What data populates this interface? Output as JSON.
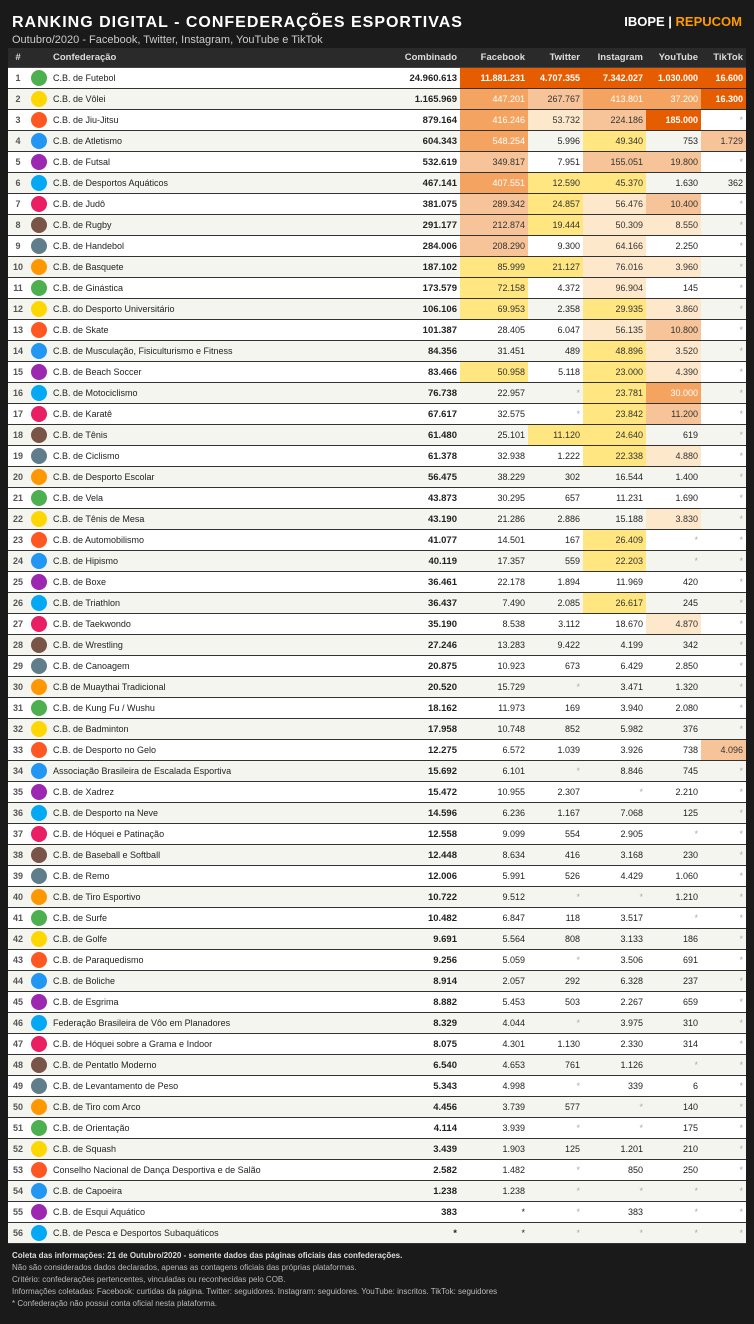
{
  "header": {
    "title": "RANKING DIGITAL - CONFEDERAÇÕES ESPORTIVAS",
    "subtitle": "Outubro/2020 - Facebook, Twitter, Instagram, YouTube e TikTok",
    "logo": "IBOPE | REPUCOM"
  },
  "columns": [
    "#",
    "",
    "Confederação",
    "Combinado",
    "Facebook",
    "Twitter",
    "Instagram",
    "YouTube",
    "TikTok"
  ],
  "rows": [
    [
      1,
      "",
      "C.B. de Futebol",
      "24.960.613",
      "11.881.231",
      "4.707.355",
      "7.342.027",
      "1.030.000",
      "16.600"
    ],
    [
      2,
      "",
      "C.B. de Vôlei",
      "1.165.969",
      "447.201",
      "267.767",
      "413.801",
      "37.200",
      "16.300"
    ],
    [
      3,
      "",
      "C.B. de Jiu-Jitsu",
      "879.164",
      "416.246",
      "53.732",
      "224.186",
      "185.000",
      "*"
    ],
    [
      4,
      "",
      "C.B. de Atletismo",
      "604.343",
      "548.254",
      "5.996",
      "49.340",
      "753",
      "1.729"
    ],
    [
      5,
      "",
      "C.B. de Futsal",
      "532.619",
      "349.817",
      "7.951",
      "155.051",
      "19.800",
      "*"
    ],
    [
      6,
      "",
      "C.B. de Desportos Aquáticos",
      "467.141",
      "407.551",
      "12.590",
      "45.370",
      "1.630",
      "362"
    ],
    [
      7,
      "",
      "C.B. de Judô",
      "381.075",
      "289.342",
      "24.857",
      "56.476",
      "10.400",
      "*"
    ],
    [
      8,
      "",
      "C.B. de Rugby",
      "291.177",
      "212.874",
      "19.444",
      "50.309",
      "8.550",
      "*"
    ],
    [
      9,
      "",
      "C.B. de Handebol",
      "284.006",
      "208.290",
      "9.300",
      "64.166",
      "2.250",
      "*"
    ],
    [
      10,
      "",
      "C.B. de Basquete",
      "187.102",
      "85.999",
      "21.127",
      "76.016",
      "3.960",
      "*"
    ],
    [
      11,
      "",
      "C.B. de Ginástica",
      "173.579",
      "72.158",
      "4.372",
      "96.904",
      "145",
      "*"
    ],
    [
      12,
      "",
      "C.B. do Desporto Universitário",
      "106.106",
      "69.953",
      "2.358",
      "29.935",
      "3.860",
      "*"
    ],
    [
      13,
      "",
      "C.B. de Skate",
      "101.387",
      "28.405",
      "6.047",
      "56.135",
      "10.800",
      "*"
    ],
    [
      14,
      "",
      "C.B. de Musculação, Fisiculturismo e Fitness",
      "84.356",
      "31.451",
      "489",
      "48.896",
      "3.520",
      "*"
    ],
    [
      15,
      "",
      "C.B. de Beach Soccer",
      "83.466",
      "50.958",
      "5.118",
      "23.000",
      "4.390",
      "*"
    ],
    [
      16,
      "",
      "C.B. de Motociclismo",
      "76.738",
      "22.957",
      "*",
      "23.781",
      "30.000",
      "*"
    ],
    [
      17,
      "",
      "C.B. de Karatê",
      "67.617",
      "32.575",
      "*",
      "23.842",
      "11.200",
      "*"
    ],
    [
      18,
      "",
      "C.B. de Tênis",
      "61.480",
      "25.101",
      "11.120",
      "24.640",
      "619",
      "*"
    ],
    [
      19,
      "",
      "C.B. de Ciclismo",
      "61.378",
      "32.938",
      "1.222",
      "22.338",
      "4.880",
      "*"
    ],
    [
      20,
      "",
      "C.B. de Desporto Escolar",
      "56.475",
      "38.229",
      "302",
      "16.544",
      "1.400",
      "*"
    ],
    [
      21,
      "",
      "C.B. de Vela",
      "43.873",
      "30.295",
      "657",
      "11.231",
      "1.690",
      "*"
    ],
    [
      22,
      "",
      "C.B. de Tênis de Mesa",
      "43.190",
      "21.286",
      "2.886",
      "15.188",
      "3.830",
      "*"
    ],
    [
      23,
      "",
      "C.B. de Automobilismo",
      "41.077",
      "14.501",
      "167",
      "26.409",
      "*",
      "*"
    ],
    [
      24,
      "",
      "C.B. de Hipismo",
      "40.119",
      "17.357",
      "559",
      "22.203",
      "*",
      "*"
    ],
    [
      25,
      "",
      "C.B. de Boxe",
      "36.461",
      "22.178",
      "1.894",
      "11.969",
      "420",
      "*"
    ],
    [
      26,
      "",
      "C.B. de Triathlon",
      "36.437",
      "7.490",
      "2.085",
      "26.617",
      "245",
      "*"
    ],
    [
      27,
      "",
      "C.B. de Taekwondo",
      "35.190",
      "8.538",
      "3.112",
      "18.670",
      "4.870",
      "*"
    ],
    [
      28,
      "",
      "C.B. de Wrestling",
      "27.246",
      "13.283",
      "9.422",
      "4.199",
      "342",
      "*"
    ],
    [
      29,
      "",
      "C.B. de Canoagem",
      "20.875",
      "10.923",
      "673",
      "6.429",
      "2.850",
      "*"
    ],
    [
      30,
      "",
      "C.B de Muaythai Tradicional",
      "20.520",
      "15.729",
      "*",
      "3.471",
      "1.320",
      "*"
    ],
    [
      31,
      "",
      "C.B. de Kung Fu / Wushu",
      "18.162",
      "11.973",
      "169",
      "3.940",
      "2.080",
      "*"
    ],
    [
      32,
      "",
      "C.B. de Badminton",
      "17.958",
      "10.748",
      "852",
      "5.982",
      "376",
      "*"
    ],
    [
      33,
      "",
      "C.B. de Desporto no Gelo",
      "12.275",
      "6.572",
      "1.039",
      "3.926",
      "738",
      "4.096"
    ],
    [
      34,
      "",
      "Associação Brasileira de Escalada Esportiva",
      "15.692",
      "6.101",
      "*",
      "8.846",
      "745",
      "*"
    ],
    [
      35,
      "",
      "C.B. de Xadrez",
      "15.472",
      "10.955",
      "2.307",
      "*",
      "2.210",
      "*"
    ],
    [
      36,
      "",
      "C.B. de Desporto na Neve",
      "14.596",
      "6.236",
      "1.167",
      "7.068",
      "125",
      "*"
    ],
    [
      37,
      "",
      "C.B. de Hóquei e Patinação",
      "12.558",
      "9.099",
      "554",
      "2.905",
      "*",
      "*"
    ],
    [
      38,
      "",
      "C.B. de Baseball e Softball",
      "12.448",
      "8.634",
      "416",
      "3.168",
      "230",
      "*"
    ],
    [
      39,
      "",
      "C.B. de Remo",
      "12.006",
      "5.991",
      "526",
      "4.429",
      "1.060",
      "*"
    ],
    [
      40,
      "",
      "C.B. de Tiro Esportivo",
      "10.722",
      "9.512",
      "*",
      "*",
      "1.210",
      "*"
    ],
    [
      41,
      "",
      "C.B. de Surfe",
      "10.482",
      "6.847",
      "118",
      "3.517",
      "*",
      "*"
    ],
    [
      42,
      "",
      "C.B. de Golfe",
      "9.691",
      "5.564",
      "808",
      "3.133",
      "186",
      "*"
    ],
    [
      43,
      "",
      "C.B. de Paraquedismo",
      "9.256",
      "5.059",
      "*",
      "3.506",
      "691",
      "*"
    ],
    [
      44,
      "",
      "C.B. de Boliche",
      "8.914",
      "2.057",
      "292",
      "6.328",
      "237",
      "*"
    ],
    [
      45,
      "",
      "C.B. de Esgrima",
      "8.882",
      "5.453",
      "503",
      "2.267",
      "659",
      "*"
    ],
    [
      46,
      "",
      "Federação Brasileira de Vôo em Planadores",
      "8.329",
      "4.044",
      "*",
      "3.975",
      "310",
      "*"
    ],
    [
      47,
      "",
      "C.B. de Hóquei sobre a Grama e Indoor",
      "8.075",
      "4.301",
      "1.130",
      "2.330",
      "314",
      "*"
    ],
    [
      48,
      "",
      "C.B. de Pentatlo Moderno",
      "6.540",
      "4.653",
      "761",
      "1.126",
      "*",
      "*"
    ],
    [
      49,
      "",
      "C.B. de Levantamento de Peso",
      "5.343",
      "4.998",
      "*",
      "339",
      "6",
      "*"
    ],
    [
      50,
      "",
      "C.B. de Tiro com Arco",
      "4.456",
      "3.739",
      "577",
      "*",
      "140",
      "*"
    ],
    [
      51,
      "",
      "C.B. de Orientação",
      "4.114",
      "3.939",
      "*",
      "*",
      "175",
      "*"
    ],
    [
      52,
      "",
      "C.B. de Squash",
      "3.439",
      "1.903",
      "125",
      "1.201",
      "210",
      "*"
    ],
    [
      53,
      "",
      "Conselho Nacional de Dança Desportiva e de Salão",
      "2.582",
      "1.482",
      "*",
      "850",
      "250",
      "*"
    ],
    [
      54,
      "",
      "C.B. de Capoeira",
      "1.238",
      "1.238",
      "*",
      "*",
      "*",
      "*"
    ],
    [
      55,
      "",
      "C.B. de Esqui Aquático",
      "383",
      "*",
      "*",
      "383",
      "*",
      "*"
    ],
    [
      56,
      "",
      "C.B. de Pesca e Desportos Subaquáticos",
      "*",
      "*",
      "*",
      "*",
      "*",
      "*"
    ]
  ],
  "footer": {
    "line1": "Coleta das informações: 21 de Outubro/2020 - somente dados das páginas oficiais das confederações.",
    "line2": "Não são considerados dados declarados, apenas as contagens oficiais das próprias plataformas.",
    "line3": "Critério: confederações pertencentes, vinculadas ou reconhecidas pelo COB.",
    "line4": "Informações coletadas: Facebook: curtidas da página. Twitter: seguidores. Instagram: seguidores. YouTube: inscritos. TikTok: seguidores",
    "line5": "* Confederação não possui conta oficial nesta plataforma."
  },
  "color_map": {
    "facebook_high": "#e65c00",
    "facebook_mid": "#f4a460",
    "twitter_high": "#f4a460",
    "instagram_high": "#f4a460",
    "youtube_high": "#f4a460",
    "tiktok_high": "#f4a460"
  }
}
